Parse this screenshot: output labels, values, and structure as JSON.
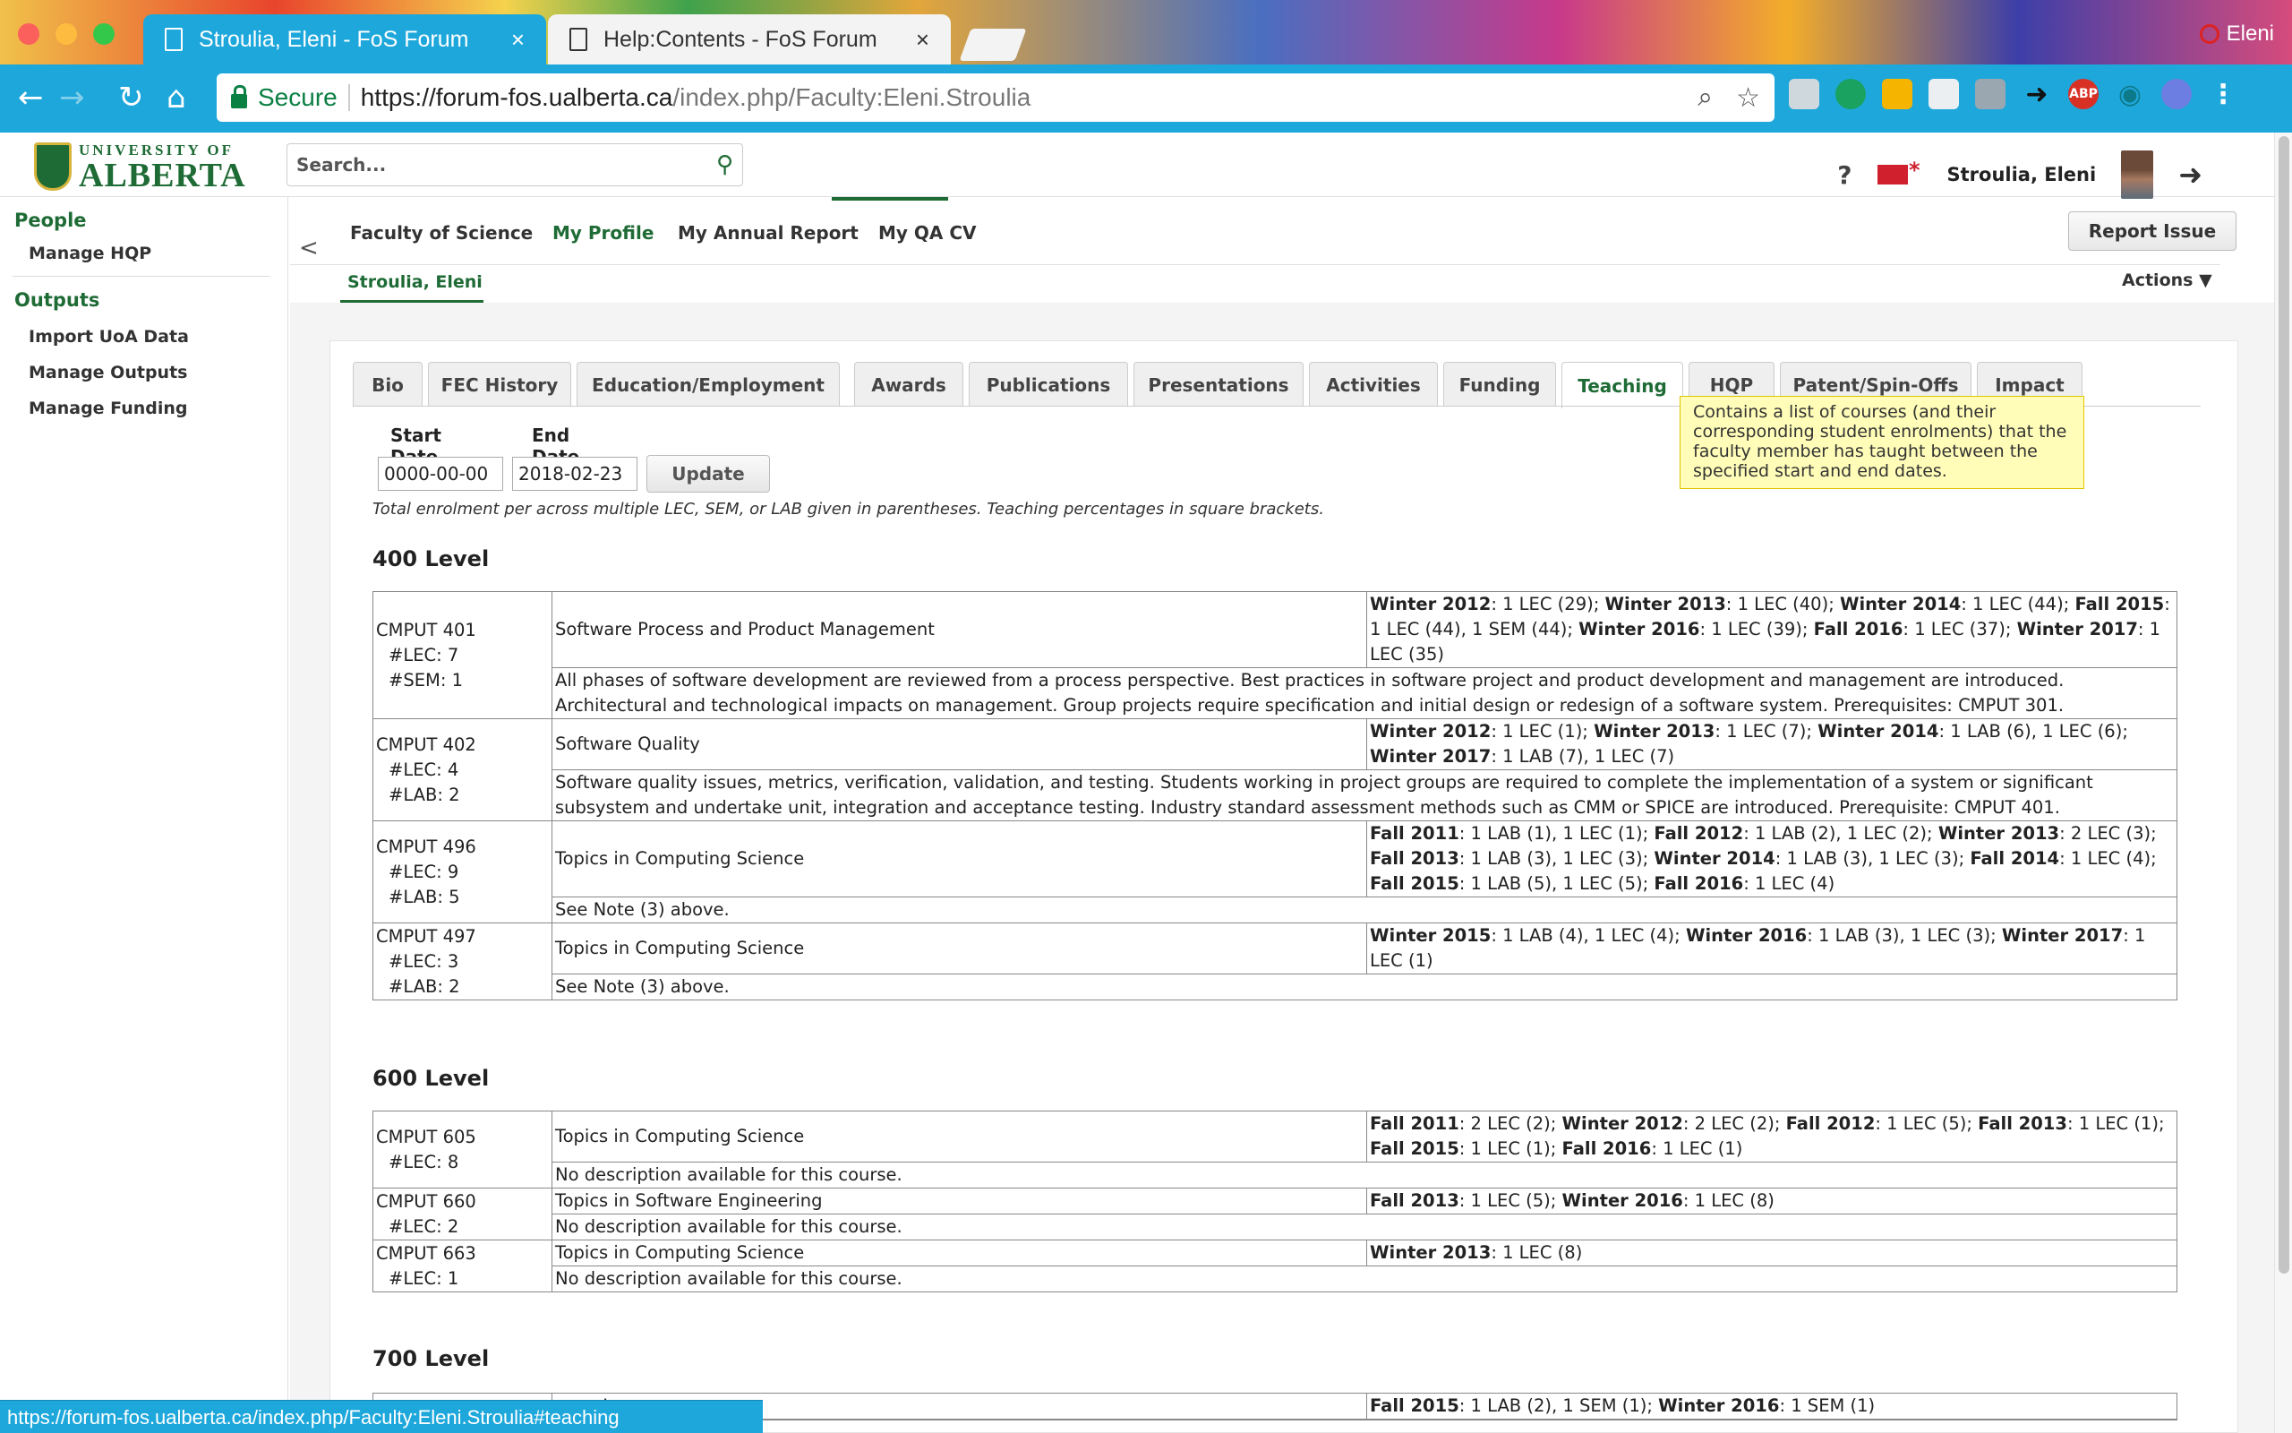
{
  "browser": {
    "tabs": [
      {
        "title": "Stroulia, Eleni - FoS Forum",
        "close": "×"
      },
      {
        "title": "Help:Contents - FoS Forum",
        "close": "×"
      }
    ],
    "profile_name": "Eleni",
    "secure_label": "Secure",
    "url_scheme_host": "https://forum-fos.ualberta.ca",
    "url_path": "/index.php/Faculty:Eleni.Stroulia",
    "status_url": "https://forum-fos.ualberta.ca/index.php/Faculty:Eleni.Stroulia#teaching",
    "extensions": [
      "ABP"
    ]
  },
  "header": {
    "logo_line1": "UNIVERSITY OF",
    "logo_line2": "ALBERTA",
    "search_placeholder": "Search...",
    "help": "?",
    "user_name": "Stroulia, Eleni"
  },
  "sidebar": {
    "sections": [
      {
        "heading": "People",
        "items": [
          "Manage HQP"
        ]
      },
      {
        "heading": "Outputs",
        "items": [
          "Import UoA Data",
          "Manage Outputs",
          "Manage Funding"
        ]
      }
    ]
  },
  "subnav": {
    "collapse": "<",
    "items": [
      "Faculty of Science",
      "My Profile",
      "My Annual Report",
      "My QA CV"
    ],
    "report_issue": "Report Issue",
    "breadcrumb": "Stroulia, Eleni",
    "actions": "Actions ▼"
  },
  "profile_tabs": [
    "Bio",
    "FEC History",
    "Education/Employment",
    "Awards",
    "Publications",
    "Presentations",
    "Activities",
    "Funding",
    "Teaching",
    "HQP",
    "Patent/Spin-Offs",
    "Impact"
  ],
  "active_tab": "Teaching",
  "tooltip": "Contains a list of courses (and their corresponding student enrolments) that the faculty member has taught between the specified start and end dates.",
  "filters": {
    "start_label": "Start Date",
    "end_label": "End Date",
    "start_value": "0000-00-00",
    "end_value": "2018-02-23",
    "update": "Update"
  },
  "note": "Total enrolment per across multiple LEC, SEM, or LAB given in parentheses. Teaching percentages in square brackets.",
  "levels": {
    "l400": {
      "heading": "400 Level",
      "courses": [
        {
          "code": "CMPUT 401",
          "counts": [
            "#LEC: 7",
            "#SEM: 1"
          ],
          "title": "Software Process and Product Management",
          "schedule": [
            [
              "Winter 2012",
              ": 1 LEC (29); "
            ],
            [
              "Winter 2013",
              ": 1 LEC (40); "
            ],
            [
              "Winter 2014",
              ": 1 LEC (44); "
            ],
            [
              "Fall 2015",
              ": 1 LEC (44), 1 SEM (44); "
            ],
            [
              "Winter 2016",
              ": 1 LEC (39); "
            ],
            [
              "Fall 2016",
              ": 1 LEC (37); "
            ],
            [
              "Winter 2017",
              ": 1 LEC (35)"
            ]
          ],
          "description": "All phases of software development are reviewed from a process perspective. Best practices in software project and product development and management are introduced. Architectural and technological impacts on management. Group projects require specification and initial design or redesign of a software system. Prerequisites: CMPUT 301."
        },
        {
          "code": "CMPUT 402",
          "counts": [
            "#LEC: 4",
            "#LAB: 2"
          ],
          "title": "Software Quality",
          "schedule": [
            [
              "Winter 2012",
              ": 1 LEC (1); "
            ],
            [
              "Winter 2013",
              ": 1 LEC (7); "
            ],
            [
              "Winter 2014",
              ": 1 LAB (6), 1 LEC (6); "
            ],
            [
              "Winter 2017",
              ": 1 LAB (7), 1 LEC (7)"
            ]
          ],
          "description": "Software quality issues, metrics, verification, validation, and testing. Students working in project groups are required to complete the implementation of a system or significant subsystem and undertake unit, integration and acceptance testing. Industry standard assessment methods such as CMM or SPICE are introduced. Prerequisite: CMPUT 401."
        },
        {
          "code": "CMPUT 496",
          "counts": [
            "#LEC: 9",
            "#LAB: 5"
          ],
          "title": "Topics in Computing Science",
          "schedule": [
            [
              "Fall 2011",
              ": 1 LAB (1), 1 LEC (1); "
            ],
            [
              "Fall 2012",
              ": 1 LAB (2), 1 LEC (2); "
            ],
            [
              "Winter 2013",
              ": 2 LEC (3); "
            ],
            [
              "Fall 2013",
              ": 1 LAB (3), 1 LEC (3); "
            ],
            [
              "Winter 2014",
              ": 1 LAB (3), 1 LEC (3); "
            ],
            [
              "Fall 2014",
              ": 1 LEC (4); "
            ],
            [
              "Fall 2015",
              ": 1 LAB (5), 1 LEC (5); "
            ],
            [
              "Fall 2016",
              ": 1 LEC (4)"
            ]
          ],
          "description": "See Note (3) above."
        },
        {
          "code": "CMPUT 497",
          "counts": [
            "#LEC: 3",
            "#LAB: 2"
          ],
          "title": "Topics in Computing Science",
          "schedule": [
            [
              "Winter 2015",
              ": 1 LAB (4), 1 LEC (4); "
            ],
            [
              "Winter 2016",
              ": 1 LAB (3), 1 LEC (3); "
            ],
            [
              "Winter 2017",
              ": 1 LEC (1)"
            ]
          ],
          "description": "See Note (3) above."
        }
      ]
    },
    "l600": {
      "heading": "600 Level",
      "courses": [
        {
          "code": "CMPUT 605",
          "counts": [
            "#LEC: 8"
          ],
          "title": "Topics in Computing Science",
          "schedule": [
            [
              "Fall 2011",
              ": 2 LEC (2); "
            ],
            [
              "Winter 2012",
              ": 2 LEC (2); "
            ],
            [
              "Fall 2012",
              ": 1 LEC (5); "
            ],
            [
              "Fall 2013",
              ": 1 LEC (1); "
            ],
            [
              "Fall 2015",
              ": 1 LEC (1); "
            ],
            [
              "Fall 2016",
              ": 1 LEC (1)"
            ]
          ],
          "description": "No description available for this course."
        },
        {
          "code": "CMPUT 660",
          "counts": [
            "#LEC: 2"
          ],
          "title": "Topics in Software Engineering",
          "schedule": [
            [
              "Fall 2013",
              ": 1 LEC (5); "
            ],
            [
              "Winter 2016",
              ": 1 LEC (8)"
            ]
          ],
          "description": "No description available for this course."
        },
        {
          "code": "CMPUT 663",
          "counts": [
            "#LEC: 1"
          ],
          "title": "Topics in Computing Science",
          "schedule": [
            [
              "Winter 2013",
              ": 1 LEC (8)"
            ]
          ],
          "description": "No description available for this course."
        }
      ]
    },
    "l700": {
      "heading": "700 Level",
      "courses": [
        {
          "code": "",
          "counts": [],
          "title": "ence I",
          "schedule": [
            [
              "Fall 2015",
              ": 1 LAB (2), 1 SEM (1); "
            ],
            [
              "Winter 2016",
              ": 1 SEM (1)"
            ]
          ],
          "description": ""
        }
      ]
    }
  },
  "colors": {
    "brand_green": "#1e6b35",
    "chrome_blue": "#1ea7db",
    "tooltip_bg": "#fffdb8"
  }
}
